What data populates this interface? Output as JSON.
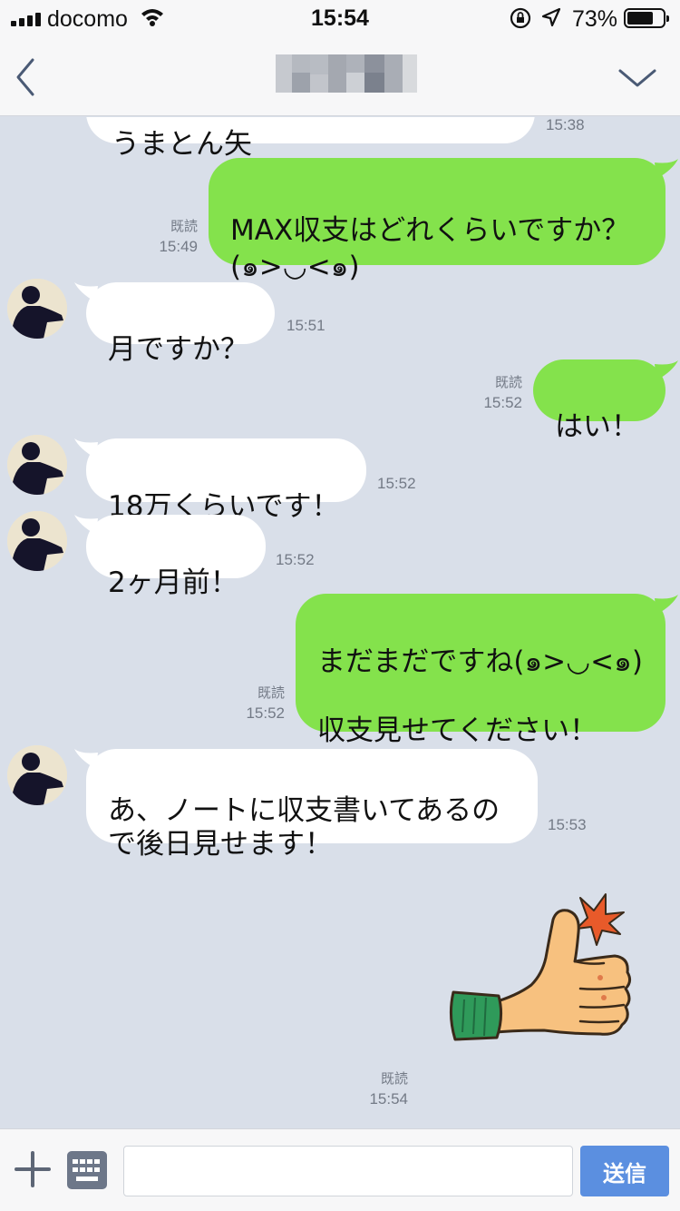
{
  "status_bar": {
    "carrier": "docomo",
    "time": "15:54",
    "battery": "73%",
    "battery_level": 0.73
  },
  "header": {
    "back_icon": "chevron-left-icon",
    "menu_icon": "chevron-down-icon"
  },
  "messages": [
    {
      "side": "in",
      "text": "うまとん矢",
      "time": "15:38",
      "read": ""
    },
    {
      "side": "out",
      "text": "MAX収支はどれくらいですか？\n(๑>◡<๑)",
      "time": "15:49",
      "read": "既読"
    },
    {
      "side": "in",
      "text": "月ですか？",
      "time": "15:51",
      "read": ""
    },
    {
      "side": "out",
      "text": "はい！",
      "time": "15:52",
      "read": "既読"
    },
    {
      "side": "in",
      "text": "18万くらいです！",
      "time": "15:52",
      "read": ""
    },
    {
      "side": "in",
      "text": "2ヶ月前！",
      "time": "15:52",
      "read": ""
    },
    {
      "side": "out",
      "text": "まだまだですね(๑>◡<๑)\n\n収支見せてください！",
      "time": "15:52",
      "read": "既読"
    },
    {
      "side": "in",
      "text": "あ、ノートに収支書いてあるの\nで後日見せます！",
      "time": "15:53",
      "read": ""
    },
    {
      "side": "out",
      "type": "sticker",
      "sticker": "thumbs-up-sticker",
      "time": "15:54",
      "read": "既読"
    }
  ],
  "input_bar": {
    "plus_icon": "plus-icon",
    "keyboard_icon": "keyboard-icon",
    "placeholder": "",
    "send_label": "送信"
  },
  "colors": {
    "chat_background": "#d9dfe9",
    "outgoing_bubble": "#84e24c",
    "incoming_bubble": "#ffffff",
    "send_button": "#5b8fe0"
  }
}
